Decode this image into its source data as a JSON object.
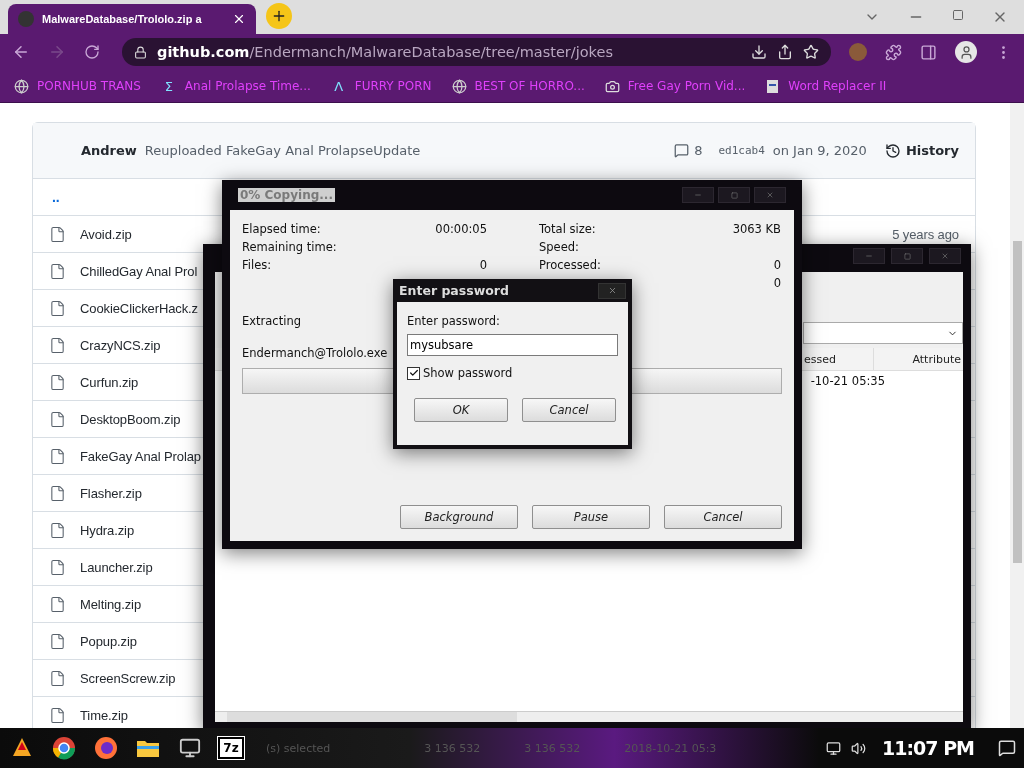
{
  "browser": {
    "tab": {
      "title": "MalwareDatabase/Trololo.zip a",
      "selected": true
    },
    "url": "**github.com**/Endermanch/MalwareDatabase/tree/master/jokes",
    "bookmarks": [
      {
        "label": "PORNHUB TRANS",
        "kind": "globe"
      },
      {
        "label": "Anal Prolapse Time...",
        "kind": "glyph",
        "icon": "Σ"
      },
      {
        "label": "FURRY PORN",
        "kind": "glyph",
        "icon": "Λ"
      },
      {
        "label": "BEST OF HORRO...",
        "kind": "globe"
      },
      {
        "label": "Free Gay Porn Vid...",
        "kind": "cam"
      },
      {
        "label": "Word Replacer II",
        "kind": "wr"
      }
    ]
  },
  "repo": {
    "commit": {
      "author": "Andrew",
      "message": "Reuploaded FakeGay Anal ProlapseUpdate",
      "comments": "8",
      "sha": "ed1cab4",
      "date": "on Jan 9, 2020",
      "history": "History"
    },
    "parent": "..",
    "files": [
      {
        "name": "Avoid.zip",
        "age": "5 years ago"
      },
      {
        "name": "ChilledGay Anal Prol"
      },
      {
        "name": "CookieClickerHack.z"
      },
      {
        "name": "CrazyNCS.zip"
      },
      {
        "name": "Curfun.zip"
      },
      {
        "name": "DesktopBoom.zip"
      },
      {
        "name": "FakeGay Anal Prolap"
      },
      {
        "name": "Flasher.zip"
      },
      {
        "name": "Hydra.zip"
      },
      {
        "name": "Launcher.zip"
      },
      {
        "name": "Melting.zip"
      },
      {
        "name": "Popup.zip"
      },
      {
        "name": "ScreenScrew.zip"
      },
      {
        "name": "Time.zip"
      }
    ]
  },
  "file_manager": {
    "columns": [
      "essed",
      "Attribute"
    ],
    "rows": [
      {
        "modified": "-10-21 05:35"
      }
    ],
    "status": [
      "(s) selected",
      "3 136 532",
      "3 136 532",
      "2018-10-21 05:3"
    ]
  },
  "copy_dialog": {
    "title": "0% Copying...",
    "left_stats": [
      {
        "label": "Elapsed time:",
        "value": "00:00:05"
      },
      {
        "label": "Remaining time:"
      },
      {
        "label": "Files:",
        "value": "0"
      }
    ],
    "right_stats": [
      {
        "label": "Total size:",
        "value": "3063 KB"
      },
      {
        "label": "Speed:"
      },
      {
        "label": "Processed:",
        "value": "0"
      },
      {
        "value": "0"
      }
    ],
    "operation": "Extracting",
    "filename": "Endermanch@Trololo.exe",
    "progress": {
      "level": 0
    },
    "buttons": [
      "Background",
      "Pause",
      "Cancel"
    ]
  },
  "password_dialog": {
    "title": "Enter password",
    "label": "Enter password:",
    "value": "mysubsare",
    "show_password": {
      "label": "Show password",
      "checked": true
    },
    "buttons": [
      "OK",
      "Cancel"
    ]
  },
  "taskbar": {
    "app_label": "7z",
    "clock": "11:07 PM"
  }
}
